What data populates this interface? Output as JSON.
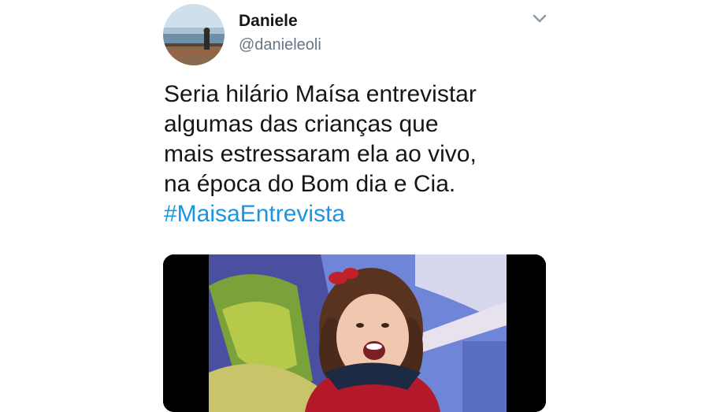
{
  "tweet": {
    "author_name": "Daniele",
    "author_handle": "@danieleoli",
    "text_lines": [
      "Seria hilário Maísa entrevistar",
      "algumas das crianças que",
      "mais estressaram ela ao vivo,",
      "na época do Bom dia e Cia."
    ],
    "hashtag": "#MaisaEntrevista",
    "menu_icon": "chevron-down-icon"
  },
  "colors": {
    "text": "#14171a",
    "secondary": "#657786",
    "link": "#1b95e0"
  }
}
